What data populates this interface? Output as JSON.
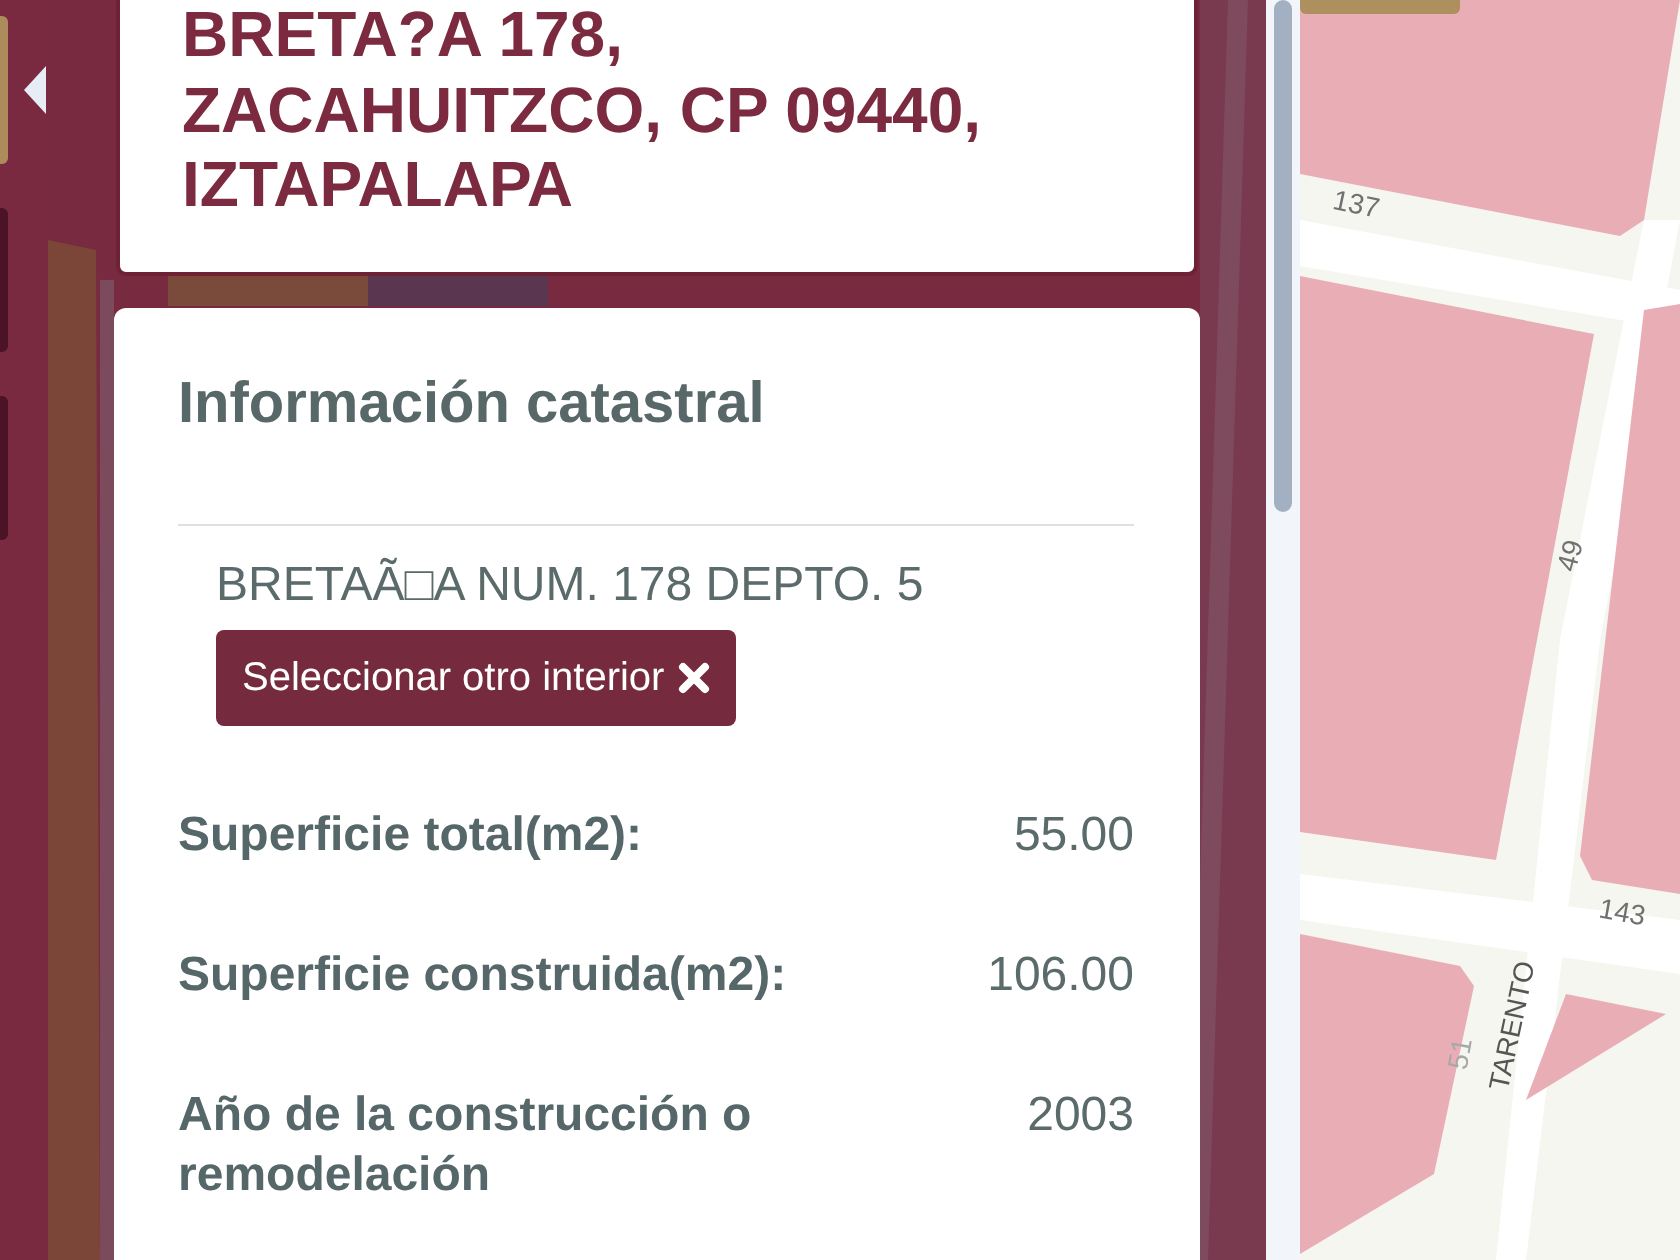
{
  "sidebar": {
    "tabs": [
      {
        "selected": true
      },
      {
        "selected": false
      },
      {
        "selected": false
      }
    ]
  },
  "address_card": {
    "title": "BRETA?A 178, ZACAHUITZCO, CP 09440, IZTAPALAPA"
  },
  "info_card": {
    "title": "Información catastral",
    "unit": "BRETAÃ□A NUM. 178 DEPTO. 5",
    "button": {
      "label": "Seleccionar otro interior"
    },
    "rows": [
      {
        "label": "Superficie total(m2):",
        "value": "55.00"
      },
      {
        "label": "Superficie construida(m2):",
        "value": "106.00"
      },
      {
        "label": "Año de la construcción o remodelación",
        "value": "2003"
      }
    ]
  },
  "map": {
    "labels": [
      "137",
      "49",
      "143",
      "TARENTO",
      "51"
    ]
  }
}
